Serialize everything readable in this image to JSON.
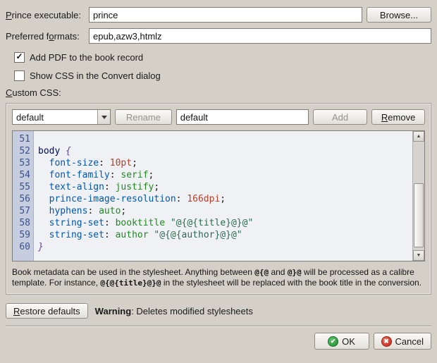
{
  "icons": {
    "check": "✓",
    "ok": "✔",
    "cancel": "✖",
    "up": "▲",
    "down": "▼"
  },
  "form": {
    "prince_label_u": "P",
    "prince_label_rest": "rince executable:",
    "prince_value": "prince",
    "browse_label": "Browse...",
    "formats_label_pre": "Preferred f",
    "formats_label_u": "o",
    "formats_label_rest": "rmats:",
    "formats_value": "epub,azw3,htmlz",
    "add_pdf_label": "Add PDF to the book record",
    "show_css_label": "Show CSS in the Convert dialog",
    "custom_css_u": "C",
    "custom_css_rest": "ustom CSS:"
  },
  "css_panel": {
    "stylesheet_selected": "default",
    "rename_label": "Rename",
    "name_value": "default",
    "add_label": "Add",
    "remove_label_u": "R",
    "remove_label_rest": "emove",
    "editor": {
      "lines": [
        {
          "num": "51",
          "tokens": []
        },
        {
          "num": "52",
          "tokens": [
            {
              "t": "body",
              "c": "sel"
            },
            {
              "t": " ",
              "c": "pln"
            },
            {
              "t": "{",
              "c": "brc"
            }
          ]
        },
        {
          "num": "53",
          "tokens": [
            {
              "t": "  ",
              "c": "pln"
            },
            {
              "t": "font-size",
              "c": "prp"
            },
            {
              "t": ": ",
              "c": "pln"
            },
            {
              "t": "10pt",
              "c": "num"
            },
            {
              "t": ";",
              "c": "pln"
            }
          ]
        },
        {
          "num": "54",
          "tokens": [
            {
              "t": "  ",
              "c": "pln"
            },
            {
              "t": "font-family",
              "c": "prp"
            },
            {
              "t": ": ",
              "c": "pln"
            },
            {
              "t": "serif",
              "c": "kw"
            },
            {
              "t": ";",
              "c": "pln"
            }
          ]
        },
        {
          "num": "55",
          "tokens": [
            {
              "t": "  ",
              "c": "pln"
            },
            {
              "t": "text-align",
              "c": "prp"
            },
            {
              "t": ": ",
              "c": "pln"
            },
            {
              "t": "justify",
              "c": "kw"
            },
            {
              "t": ";",
              "c": "pln"
            }
          ]
        },
        {
          "num": "56",
          "tokens": [
            {
              "t": "  ",
              "c": "pln"
            },
            {
              "t": "prince-image-resolution",
              "c": "prp"
            },
            {
              "t": ": ",
              "c": "pln"
            },
            {
              "t": "166dpi",
              "c": "num"
            },
            {
              "t": ";",
              "c": "pln"
            }
          ]
        },
        {
          "num": "57",
          "tokens": [
            {
              "t": "  ",
              "c": "pln"
            },
            {
              "t": "hyphens",
              "c": "prp"
            },
            {
              "t": ": ",
              "c": "pln"
            },
            {
              "t": "auto",
              "c": "kw"
            },
            {
              "t": ";",
              "c": "pln"
            }
          ]
        },
        {
          "num": "58",
          "tokens": [
            {
              "t": "  ",
              "c": "pln"
            },
            {
              "t": "string-set",
              "c": "prp"
            },
            {
              "t": ": ",
              "c": "pln"
            },
            {
              "t": "booktitle",
              "c": "kw"
            },
            {
              "t": " ",
              "c": "pln"
            },
            {
              "t": "\"@{@{title}@}@\"",
              "c": "str"
            }
          ]
        },
        {
          "num": "59",
          "tokens": [
            {
              "t": "  ",
              "c": "pln"
            },
            {
              "t": "string-set",
              "c": "prp"
            },
            {
              "t": ": ",
              "c": "pln"
            },
            {
              "t": "author",
              "c": "kw"
            },
            {
              "t": " ",
              "c": "pln"
            },
            {
              "t": "\"@{@{author}@}@\"",
              "c": "str"
            }
          ]
        },
        {
          "num": "60",
          "tokens": [
            {
              "t": "}",
              "c": "brc"
            }
          ]
        }
      ]
    },
    "help_parts": [
      {
        "t": "Book metadata can be used in the stylesheet. Anything between ",
        "b": false
      },
      {
        "t": "@{@",
        "b": true
      },
      {
        "t": " and ",
        "b": false
      },
      {
        "t": "@}@",
        "b": true
      },
      {
        "t": " will be processed as a calibre template. For instance, ",
        "b": false
      },
      {
        "t": "@{@{title}@}@",
        "b": true
      },
      {
        "t": " in the stylesheet will be replaced with the book title in the conversion.",
        "b": false
      }
    ]
  },
  "footer": {
    "restore_u": "R",
    "restore_rest": "estore defaults",
    "warning_label": "Warning",
    "warning_text": ": Deletes modified stylesheets",
    "ok_label": "OK",
    "cancel_label": "Cancel"
  }
}
